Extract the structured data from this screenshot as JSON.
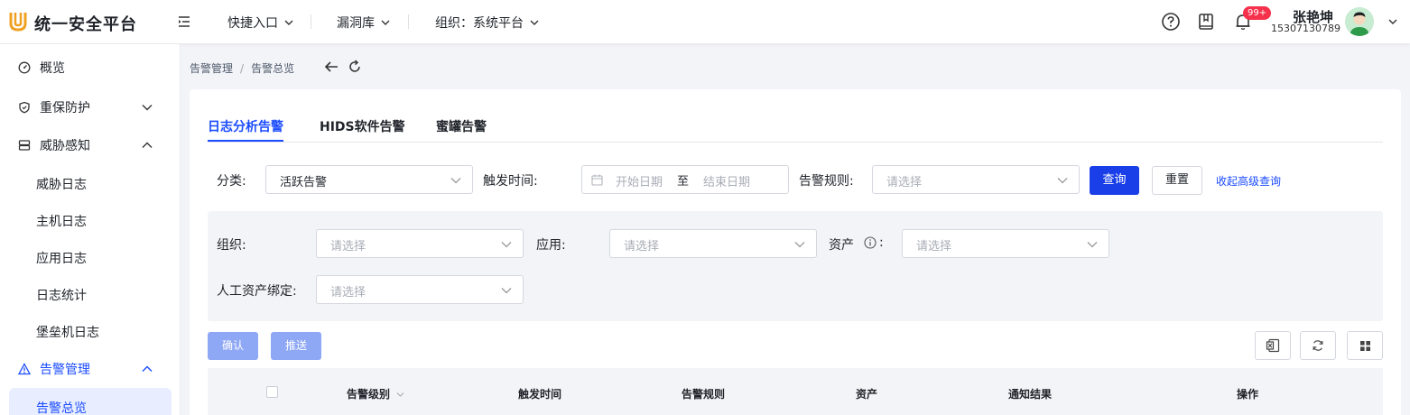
{
  "header": {
    "app_title": "统一安全平台",
    "nav": [
      {
        "label": "快捷入口"
      },
      {
        "label": "漏洞库"
      },
      {
        "label": "组织：系统平台"
      }
    ],
    "notification_badge": "99+",
    "user": {
      "name": "张艳坤",
      "phone": "15307130789"
    }
  },
  "sidebar": {
    "items": [
      {
        "label": "概览",
        "icon": "dashboard-icon"
      },
      {
        "label": "重保防护",
        "icon": "shield-icon"
      },
      {
        "label": "威胁感知",
        "icon": "server-icon"
      }
    ],
    "threat_children": [
      "威胁日志",
      "主机日志",
      "应用日志",
      "日志统计",
      "堡垒机日志"
    ],
    "alert_group": {
      "label": "告警管理",
      "icon": "warning-icon"
    },
    "selected": "告警总览"
  },
  "breadcrumb": {
    "parent": "告警管理",
    "sep": "/",
    "current": "告警总览"
  },
  "tabs": [
    {
      "label": "日志分析告警",
      "active": true
    },
    {
      "label": "HIDS软件告警",
      "active": false
    },
    {
      "label": "蜜罐告警",
      "active": false
    }
  ],
  "filters": {
    "category": {
      "label": "分类:",
      "value": "活跃告警"
    },
    "trigger_time": {
      "label": "触发时间:",
      "start_placeholder": "开始日期",
      "to": "至",
      "end_placeholder": "结束日期"
    },
    "rule": {
      "label": "告警规则:",
      "placeholder": "请选择"
    },
    "query_button": "查询",
    "reset_button": "重置",
    "collapse_link": "收起高级查询"
  },
  "advanced": {
    "org": {
      "label": "组织:",
      "placeholder": "请选择"
    },
    "app": {
      "label": "应用:",
      "placeholder": "请选择"
    },
    "asset": {
      "label": "资产",
      "colon": ":",
      "placeholder": "请选择"
    },
    "manual_binding": {
      "label": "人工资产绑定:",
      "placeholder": "请选择"
    }
  },
  "actions": {
    "confirm": "确认",
    "push": "推送"
  },
  "table": {
    "columns": [
      "告警级别",
      "触发时间",
      "告警规则",
      "资产",
      "通知结果",
      "操作"
    ]
  },
  "colors": {
    "primary": "#1a3fe8",
    "accent": "#1a4bff",
    "badge": "#f5314c",
    "logo": "#f0a020"
  }
}
